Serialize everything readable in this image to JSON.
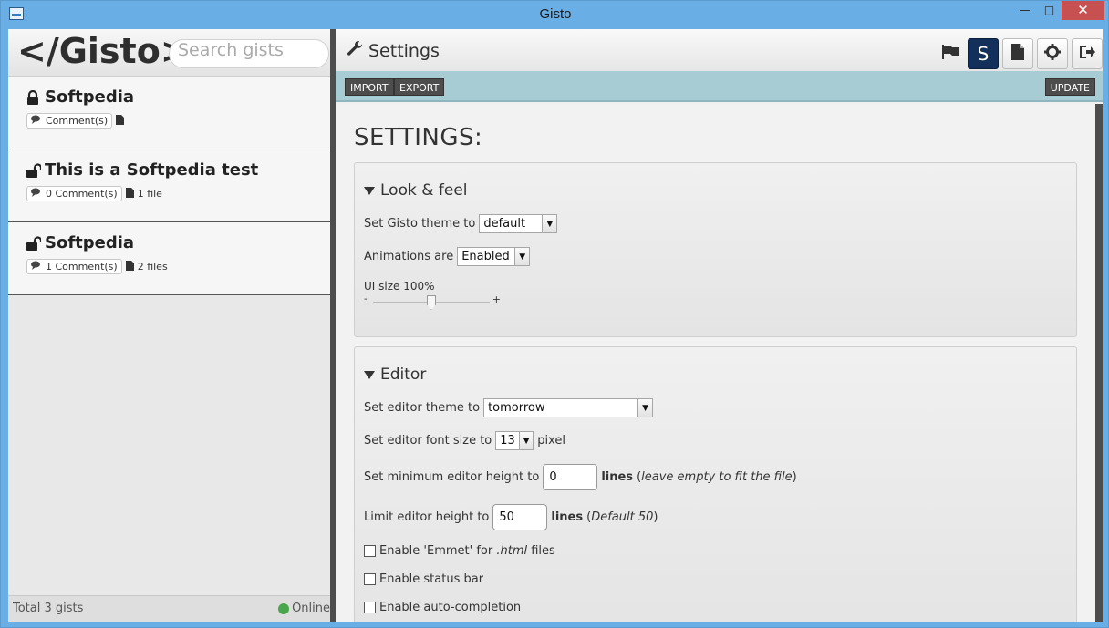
{
  "window": {
    "title": "Gisto",
    "controls": {
      "minimize": "—",
      "maximize": "□",
      "close": "✕"
    }
  },
  "sidebar": {
    "logo": "</Gisto>",
    "search_placeholder": "Search gists",
    "gists": [
      {
        "title": "Softpedia",
        "locked": true,
        "comments": "Comment(s)",
        "files": ""
      },
      {
        "title": "This is a Softpedia test",
        "locked": false,
        "comments": "0 Comment(s)",
        "files": "1 file"
      },
      {
        "title": "Softpedia",
        "locked": false,
        "comments": "1 Comment(s)",
        "files": "2 files"
      }
    ],
    "footer": {
      "total": "Total 3 gists",
      "status": "Online"
    }
  },
  "main": {
    "header_title": "Settings",
    "toolbar": {
      "user_initial": "S"
    },
    "actions": {
      "import": "IMPORT",
      "export": "EXPORT",
      "update": "UPDATE"
    },
    "page_heading": "SETTINGS:",
    "look_feel": {
      "title": "Look & feel",
      "theme_label": "Set Gisto theme to",
      "theme_value": "default",
      "animations_label": "Animations are",
      "animations_value": "Enabled",
      "ui_size_label": "UI size 100%",
      "ui_size_value": 0.5,
      "slider_min": "-",
      "slider_max": "+"
    },
    "editor": {
      "title": "Editor",
      "theme_label": "Set editor theme to",
      "theme_value": "tomorrow",
      "font_label": "Set editor font size to",
      "font_value": "13",
      "font_unit": "pixel",
      "min_height_label": "Set minimum editor height to",
      "min_height_value": "0",
      "min_height_unit": "lines",
      "min_height_note": "leave empty to fit the file",
      "limit_label": "Limit editor height to",
      "limit_value": "50",
      "limit_unit": "lines",
      "limit_note": "Default 50",
      "emmet_pre": "Enable 'Emmet' for ",
      "emmet_ext": ".html",
      "emmet_post": " files",
      "status_bar": "Enable status bar",
      "autocomplete": "Enable auto-completion"
    }
  }
}
